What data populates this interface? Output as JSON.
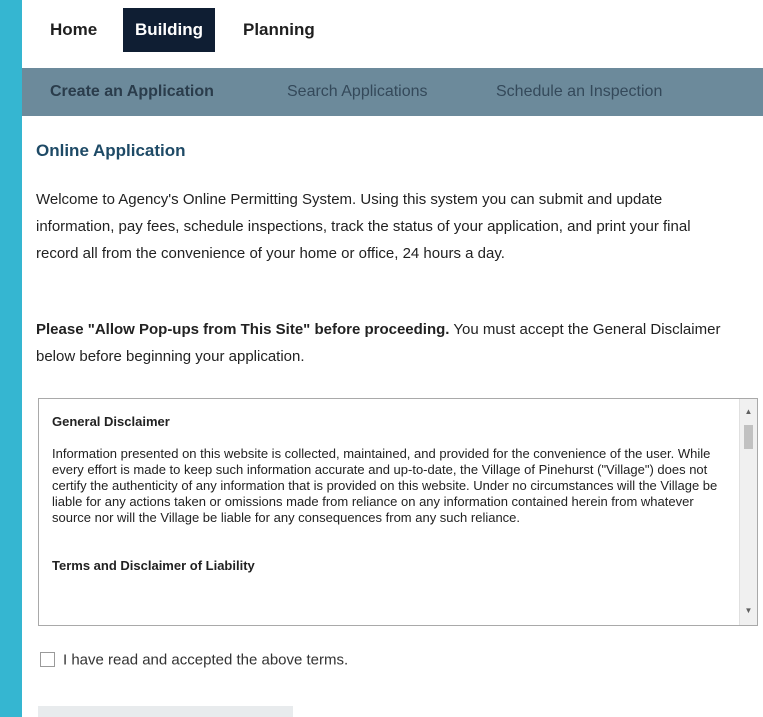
{
  "nav": {
    "home": "Home",
    "building": "Building",
    "planning": "Planning"
  },
  "subnav": {
    "create": "Create an Application",
    "search": "Search Applications",
    "schedule": "Schedule an Inspection"
  },
  "page": {
    "title": "Online Application",
    "welcome": "Welcome to Agency's Online Permitting System. Using this system you can submit and update information, pay fees, schedule inspections, track the status of your application, and print your final record all from the convenience of your home or office, 24 hours a day.",
    "popup_bold": "Please \"Allow Pop-ups from This Site\" before proceeding.",
    "popup_rest": " You must accept the General Disclaimer below before beginning your application."
  },
  "disclaimer": {
    "heading": "General Disclaimer",
    "body": "Information presented on this website is collected, maintained, and provided for the convenience of the user.  While every effort is made to keep such information accurate and up-to-date, the Village of Pinehurst (\"Village\") does not certify the authenticity of any information that is provided on this website.  Under no circumstances will the Village be liable for any actions taken or omissions made from reliance on any information contained herein from whatever source nor will the Village be liable for any consequences from any such reliance.",
    "heading2": "Terms and Disclaimer of Liability",
    "scroll_up_icon": "triangle-up",
    "scroll_down_icon": "triangle-down"
  },
  "accept": {
    "label": "I have read and accepted the above terms.",
    "checked": false
  },
  "colors": {
    "background": "#35b6d1",
    "nav_active": "#0f1e33",
    "subnav": "#6c8a9b",
    "title": "#1e4a66"
  }
}
